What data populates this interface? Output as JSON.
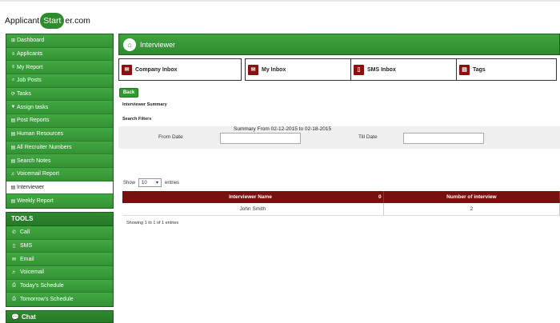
{
  "logo": {
    "prefix": "Applicant",
    "badge": "Start",
    "suffix": "er.com"
  },
  "sidebar": {
    "items": [
      {
        "label": "Dashboard",
        "icon": "⊞",
        "name": "dashboard"
      },
      {
        "label": "Applicants",
        "icon": "≡",
        "name": "applicants"
      },
      {
        "label": "My Report",
        "icon": "≡",
        "name": "my-report"
      },
      {
        "label": "Job Posts",
        "icon": "⌕",
        "name": "job-posts"
      },
      {
        "label": "Tasks",
        "icon": "⟳",
        "name": "tasks"
      },
      {
        "label": "Assign tasks",
        "icon": "▼",
        "name": "assign-tasks"
      },
      {
        "label": "Post Reports",
        "icon": "▤",
        "name": "post-reports"
      },
      {
        "label": "Human Resources",
        "icon": "▤",
        "name": "human-resources"
      },
      {
        "label": "All Recruiter Numbers",
        "icon": "▤",
        "name": "all-recruiter-numbers"
      },
      {
        "label": "Search Notes",
        "icon": "▤",
        "name": "search-notes"
      },
      {
        "label": "Voicemail Report",
        "icon": "♬",
        "name": "voicemail-report"
      },
      {
        "label": "Interviewer",
        "icon": "▤",
        "name": "interviewer"
      },
      {
        "label": "Weekly Report",
        "icon": "▤",
        "name": "weekly-report"
      }
    ],
    "active_index": 11,
    "tools": {
      "title": "TOOLS",
      "items": [
        {
          "label": "Call",
          "icon": "✆",
          "name": "call"
        },
        {
          "label": "SMS",
          "icon": "▯",
          "name": "sms"
        },
        {
          "label": "Email",
          "icon": "✉",
          "name": "email"
        },
        {
          "label": "Voicemail",
          "icon": "♬",
          "name": "voicemail"
        },
        {
          "label": "Today's Schedule",
          "icon": "⎙",
          "name": "todays-schedule"
        },
        {
          "label": "Tomorrow's Schedule",
          "icon": "⎙",
          "name": "tomorrows-schedule"
        }
      ]
    },
    "chat": "Chat"
  },
  "header": {
    "title": "Interviewer"
  },
  "cards": [
    {
      "label": "Company Inbox",
      "icon": "✉",
      "name": "company-inbox"
    },
    {
      "label": "My Inbox",
      "icon": "✉",
      "name": "my-inbox"
    },
    {
      "label": "SMS Inbox",
      "icon": "▯",
      "name": "sms-inbox"
    },
    {
      "label": "Tags",
      "icon": "▤",
      "name": "tags"
    }
  ],
  "back_label": "Back",
  "summary_title": "Interviewer Summary",
  "filters": {
    "title": "Search Filters",
    "from_label": "From Date",
    "from_value": "",
    "till_label": "Till Date",
    "till_value": ""
  },
  "summary_range": "Summary From 02-12-2015 to 02-18-2015",
  "table_controls": {
    "show_label": "Show",
    "entries_value": "10",
    "entries_label": "entries"
  },
  "table": {
    "headers": [
      "Interviewer Name",
      "0",
      "Number of interview"
    ],
    "rows": [
      [
        "John Smith",
        "2"
      ]
    ]
  },
  "showing_text": "Showing 1 to 1 of 1 entries",
  "colors": {
    "green": "#2e8b2e",
    "maroon": "#7a0f0f"
  }
}
